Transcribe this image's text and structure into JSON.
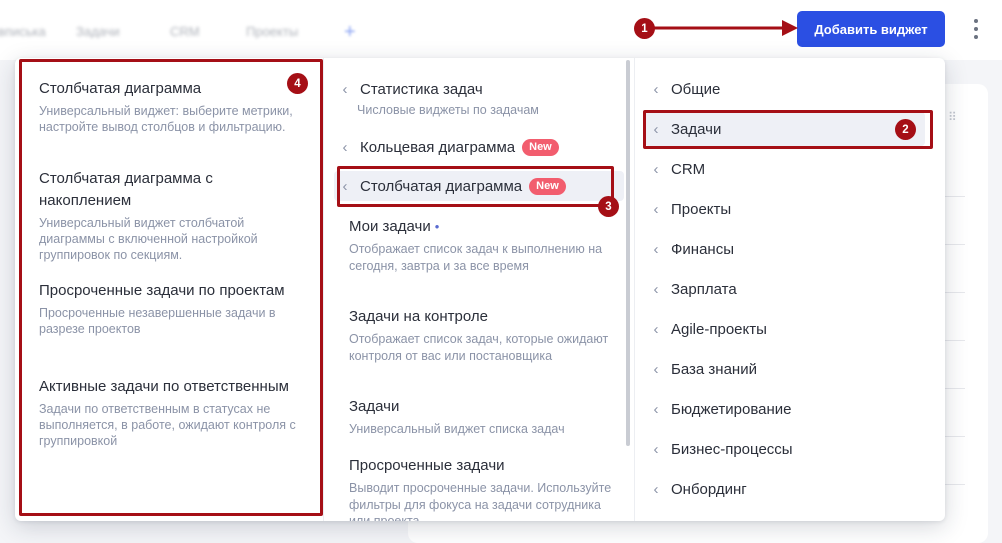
{
  "background": {
    "tabs": [
      "вписька",
      "Задачи",
      "CRM",
      "Проекты"
    ],
    "plus": "+"
  },
  "header": {
    "add_widget_label": "Добавить виджет",
    "more_icon": "kebab-vertical-icon"
  },
  "left_panel": {
    "widgets": [
      {
        "title": "Столбчатая диаграмма",
        "desc": "Универсальный виджет: выберите метрики, настройте вывод столбцов и фильтрацию."
      },
      {
        "title": "Столбчатая диаграмма с накоплением",
        "desc": "Универсальный виджет столбчатой диаграммы с включенной настройкой группировок по секциям."
      },
      {
        "title": "Просроченные задачи по проектам",
        "desc": "Просроченные незавершенные задачи в разрезе проектов"
      },
      {
        "title": "Активные задачи по ответственным",
        "desc": "Задачи по ответственным в статусах не выполняется, в работе, ожидают контроля с группировкой"
      }
    ]
  },
  "middle_panel": {
    "categories": [
      {
        "label": "Статистика задач",
        "subtitle": "Числовые виджеты по задачам"
      },
      {
        "label": "Кольцевая диаграмма",
        "badge": "New"
      },
      {
        "label": "Столбчатая диаграмма",
        "badge": "New"
      }
    ],
    "widgets": [
      {
        "title": "Мои задачи",
        "dot": "•",
        "desc": "Отображает список задач к выполнению на сегодня, завтра и за все время"
      },
      {
        "title": "Задачи на контроле",
        "desc": "Отображает список задач, которые ожидают контроля от вас или постановщика"
      },
      {
        "title": "Задачи",
        "desc": "Универсальный виджет списка задач"
      },
      {
        "title": "Просроченные задачи",
        "desc": "Выводит просроченные задачи. Используйте фильтры для фокуса на задачи сотрудника или проекта"
      }
    ]
  },
  "right_panel": {
    "categories": [
      "Общие",
      "Задачи",
      "CRM",
      "Проекты",
      "Финансы",
      "Зарплата",
      "Agile-проекты",
      "База знаний",
      "Бюджетирование",
      "Бизнес-процессы",
      "Онбординг"
    ],
    "active_index": 1
  },
  "annotations": {
    "markers": [
      "1",
      "2",
      "3",
      "4"
    ],
    "color": "#a50f16"
  },
  "colors": {
    "accent": "#2b4fe3",
    "badge": "#f25d6e",
    "annotation": "#a50f16"
  }
}
